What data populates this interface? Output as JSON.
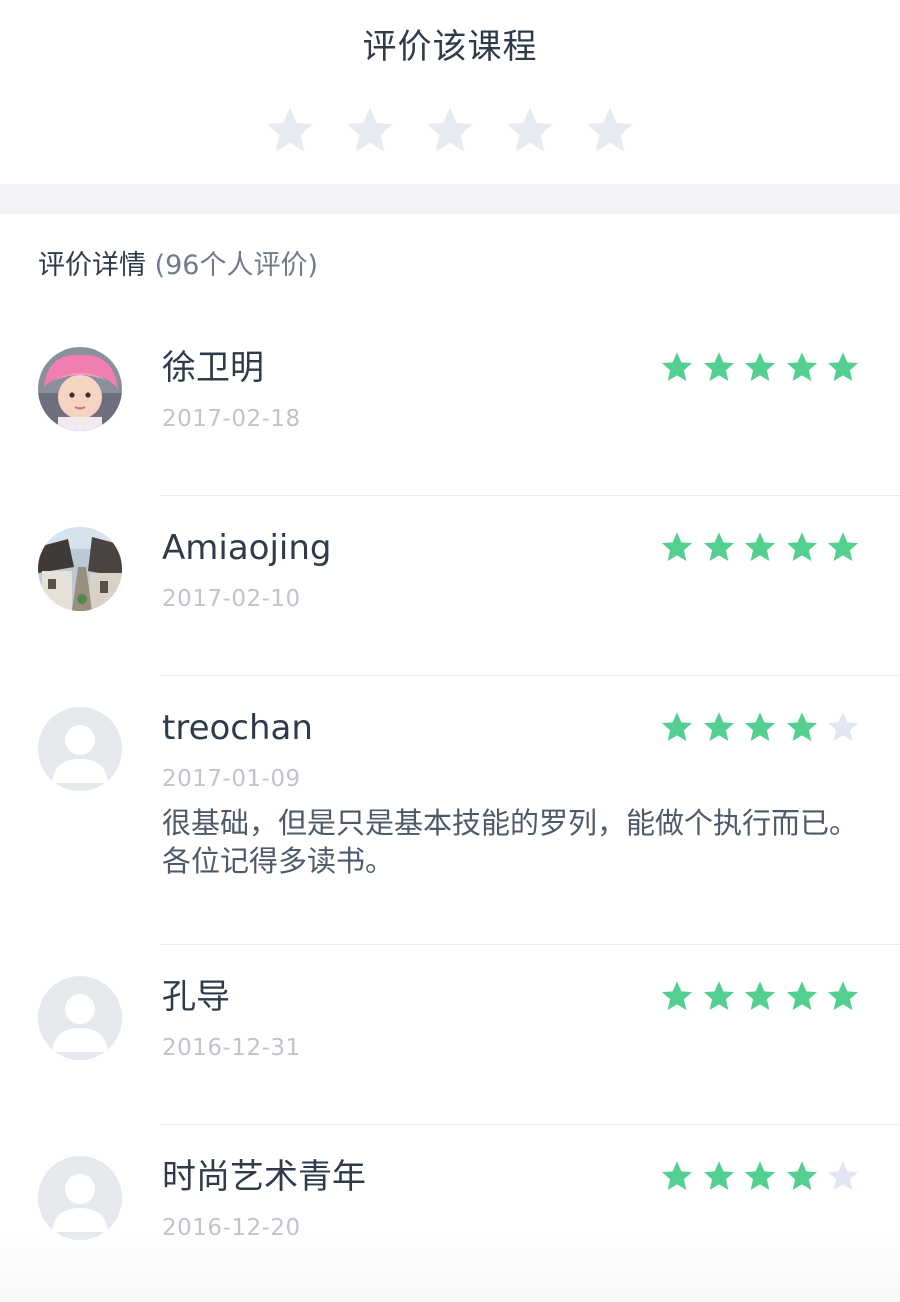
{
  "rate": {
    "title": "评价该课程",
    "star_count": 5,
    "user_rating": 0,
    "star_color_empty": "#e6eaf1"
  },
  "reviews": {
    "heading": "评价详情",
    "count_text": "(96个人评价)",
    "star_color_filled": "#53d08f",
    "star_color_empty": "#e1e6f3",
    "items": [
      {
        "name": "徐卫明",
        "date": "2017-02-18",
        "rating": 5,
        "comment": "",
        "avatar": "photo-baby-avatar"
      },
      {
        "name": "Amiaojing",
        "date": "2017-02-10",
        "rating": 5,
        "comment": "",
        "avatar": "photo-village-avatar"
      },
      {
        "name": "treochan",
        "date": "2017-01-09",
        "rating": 4,
        "comment": "很基础，但是只是基本技能的罗列，能做个执行而已。各位记得多读书。",
        "avatar": "default-avatar"
      },
      {
        "name": "孔导",
        "date": "2016-12-31",
        "rating": 5,
        "comment": "",
        "avatar": "default-avatar"
      },
      {
        "name": "时尚艺术青年",
        "date": "2016-12-20",
        "rating": 4,
        "comment": "",
        "avatar": "default-avatar"
      }
    ]
  }
}
